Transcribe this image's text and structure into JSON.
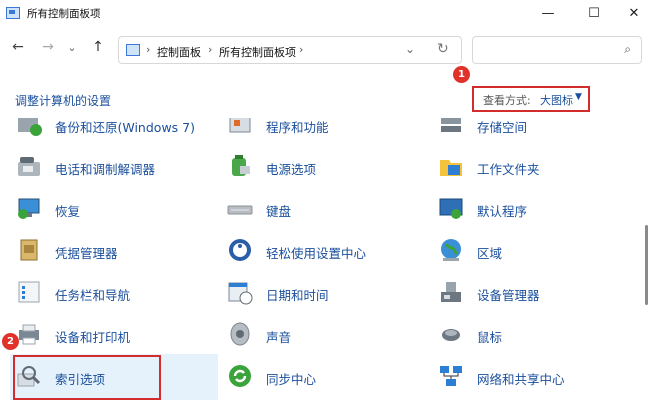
{
  "window": {
    "title": "所有控制面板项",
    "min_label": "—",
    "max_label": "☐",
    "close_label": "✕"
  },
  "nav": {
    "back": "←",
    "forward": "→",
    "dropdown": "⌄",
    "up": "↑"
  },
  "address": {
    "sep1": "›",
    "crumb1": "控制面板",
    "sep2": "›",
    "crumb2": "所有控制面板项",
    "sep3": "›",
    "dropdown": "⌄",
    "refresh": "↻"
  },
  "search": {
    "placeholder": "",
    "icon": "⌕"
  },
  "heading": "调整计算机的设置",
  "view": {
    "label": "查看方式:",
    "value": "大图标",
    "caret": "▼"
  },
  "annotations": {
    "badge1": "1",
    "badge2": "2"
  },
  "items": {
    "c0r0": "备份和还原(Windows 7)",
    "c1r0": "程序和功能",
    "c2r0": "存储空间",
    "c0r1": "电话和调制解调器",
    "c1r1": "电源选项",
    "c2r1": "工作文件夹",
    "c0r2": "恢复",
    "c1r2": "键盘",
    "c2r2": "默认程序",
    "c0r3": "凭据管理器",
    "c1r3": "轻松使用设置中心",
    "c2r3": "区域",
    "c0r4": "任务栏和导航",
    "c1r4": "日期和时间",
    "c2r4": "设备管理器",
    "c0r5": "设备和打印机",
    "c1r5": "声音",
    "c2r5": "鼠标",
    "c0r6": "索引选项",
    "c1r6": "同步中心",
    "c2r6": "网络和共享中心"
  },
  "icons": {
    "c0r0": "backup-restore-icon",
    "c1r0": "programs-features-icon",
    "c2r0": "storage-spaces-icon",
    "c0r1": "phone-modem-icon",
    "c1r1": "power-options-icon",
    "c2r1": "work-folders-icon",
    "c0r2": "recovery-icon",
    "c1r2": "keyboard-icon",
    "c2r2": "default-programs-icon",
    "c0r3": "credential-manager-icon",
    "c1r3": "ease-of-access-icon",
    "c2r3": "region-icon",
    "c0r4": "taskbar-navigation-icon",
    "c1r4": "date-time-icon",
    "c2r4": "device-manager-icon",
    "c0r5": "devices-printers-icon",
    "c1r5": "sound-icon",
    "c2r5": "mouse-icon",
    "c0r6": "indexing-options-icon",
    "c1r6": "sync-center-icon",
    "c2r6": "network-sharing-icon"
  },
  "colors": {
    "link": "#1a4f9c",
    "annotation_red": "#d22c2c",
    "selection": "#e5f1fb"
  }
}
